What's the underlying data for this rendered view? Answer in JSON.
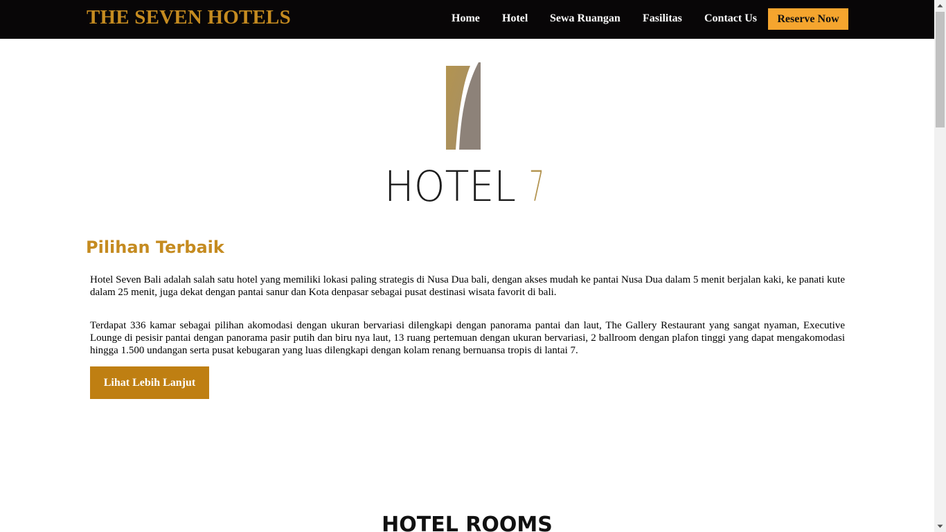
{
  "brand": "THE SEVEN HOTELS",
  "nav": {
    "items": [
      "Home",
      "Hotel",
      "Sewa Ruangan",
      "Fasilitas",
      "Contact Us"
    ],
    "reserve_label": "Reserve Now"
  },
  "logo": {
    "text": "HOTEL",
    "digit": "7"
  },
  "about": {
    "title": "Pilihan Terbaik",
    "paragraphs": [
      "Hotel Seven Bali adalah salah satu hotel yang memiliki lokasi paling strategis di Nusa Dua bali, dengan akses mudah ke pantai Nusa Dua dalam 5 menit berjalan kaki, ke panati kute dalam 25 menit, juga dekat dengan pantai sanur dan Kota denpasar sebagai pusat destinasi wisata favorit di bali.",
      "Terdapat 336 kamar sebagai pilihan akomodasi dengan ukuran bervariasi dilengkapi dengan panorama pantai dan laut, The Gallery Restaurant yang sangat nyaman, Executive Lounge di pesisir pantai dengan panorama pasir putih dan biru nya laut, 13 ruang pertemuan dengan ukuran bervariasi, 2 ballroom dengan plafon tinggi yang dapat mengakomodasi hingga 1.500 undangan serta pusat kebugaran yang luas dilengkapi dengan kolam renang bernuansa tropis di lantai 7."
    ],
    "button_label": "Lihat Lebih Lanjut"
  },
  "rooms_title": "HOTEL ROOMS",
  "colors": {
    "accent": "#c58b20",
    "reserve": "#f5a52e",
    "button": "#bf7f12",
    "navbar": "#080607",
    "logo_gold": "#b39450",
    "logo_gray": "#8d8279"
  }
}
